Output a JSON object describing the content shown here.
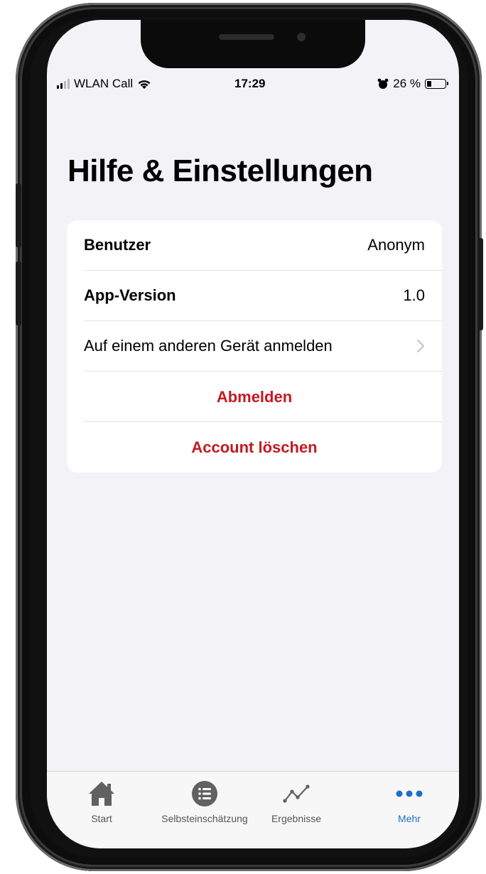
{
  "status_bar": {
    "carrier": "WLAN Call",
    "time": "17:29",
    "battery": "26 %",
    "battery_level": 0.26
  },
  "page": {
    "title": "Hilfe & Einstellungen"
  },
  "settings": {
    "user_label": "Benutzer",
    "user_value": "Anonym",
    "version_label": "App-Version",
    "version_value": "1.0",
    "other_device": "Auf einem anderen Gerät anmelden",
    "logout": "Abmelden",
    "delete_account": "Account löschen"
  },
  "tabbar": {
    "items": [
      {
        "label": "Start",
        "icon": "house-icon"
      },
      {
        "label": "Selbsteinschätzung",
        "icon": "list-icon"
      },
      {
        "label": "Ergebnisse",
        "icon": "chart-line-icon"
      },
      {
        "label": "Mehr",
        "icon": "more-icon"
      }
    ]
  },
  "colors": {
    "danger": "#c4191f",
    "accent": "#1d6fc4",
    "background": "#f2f2f7"
  }
}
